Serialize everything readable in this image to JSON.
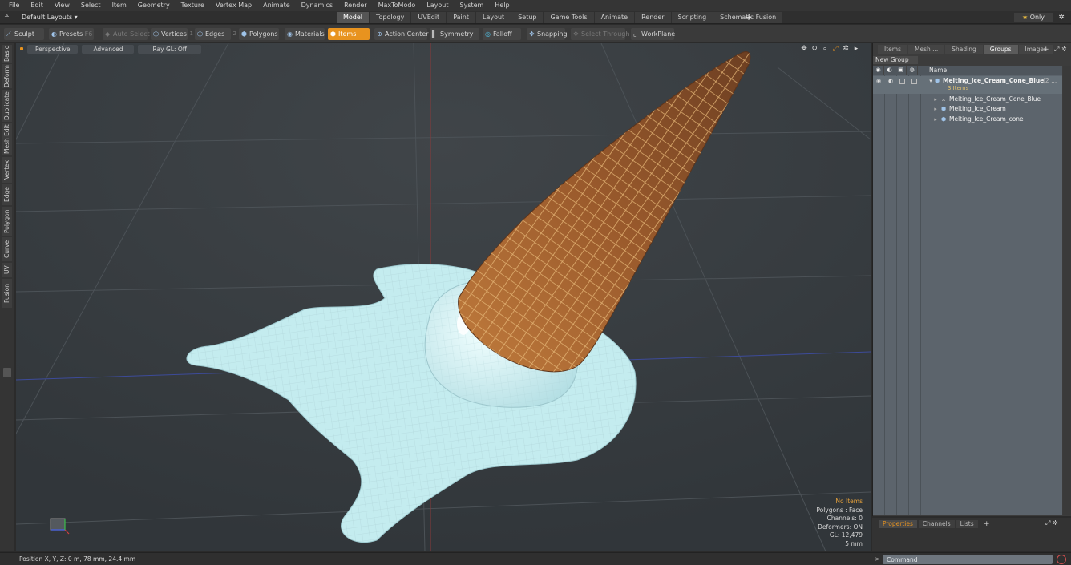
{
  "menubar": [
    "File",
    "Edit",
    "View",
    "Select",
    "Item",
    "Geometry",
    "Texture",
    "Vertex Map",
    "Animate",
    "Dynamics",
    "Render",
    "MaxToModo",
    "Layout",
    "System",
    "Help"
  ],
  "layout": {
    "selected": "Default Layouts ▾",
    "tabs": [
      "Model",
      "Topology",
      "UVEdit",
      "Paint",
      "Layout",
      "Setup",
      "Game Tools",
      "Animate",
      "Render",
      "Scripting",
      "Schematic Fusion"
    ],
    "active_tab": "Model",
    "add": "+",
    "only_star": "★",
    "only_label": "Only"
  },
  "toolbar": {
    "sculpt": "Sculpt",
    "presets": "Presets",
    "presets_key": "F6",
    "auto_select": "Auto Select",
    "vertices": "Vertices",
    "vertices_key": "1",
    "edges": "Edges",
    "edges_key": "2",
    "polygons": "Polygons",
    "materials": "Materials",
    "items": "Items",
    "action_center": "Action Center",
    "symmetry": "Symmetry",
    "falloff": "Falloff",
    "snapping": "Snapping",
    "select_through": "Select Through",
    "workplane": "WorkPlane"
  },
  "side_tabs": [
    "Basic",
    "Deform",
    "Duplicate",
    "Mesh Edit",
    "Vertex",
    "Edge",
    "Polygon",
    "Curve",
    "UV",
    "Fusion"
  ],
  "viewport": {
    "view": "Perspective",
    "mode": "Advanced",
    "raygl": "Ray GL: Off",
    "stats": {
      "items": "No Items",
      "polygons": "Polygons : Face",
      "channels": "Channels: 0",
      "deformers": "Deformers: ON",
      "gl": "GL: 12,479",
      "unit": "5 mm"
    }
  },
  "right_panel": {
    "tabs": [
      "Items",
      "Mesh ...",
      "Shading",
      "Groups",
      "Images"
    ],
    "active_tab": "Groups",
    "new_group": "New Group",
    "col_name": "Name",
    "group_name": "Melting_Ice_Cream_Cone_Blue",
    "group_suffix": "(2 ...",
    "group_count": "3 Items",
    "children": [
      "Melting_Ice_Cream_Cone_Blue",
      "Melting_Ice_Cream",
      "Melting_Ice_Cream_cone"
    ]
  },
  "properties": {
    "tabs": [
      "Properties",
      "Channels",
      "Lists"
    ],
    "active_tab": "Properties"
  },
  "statusbar": {
    "position": "Position X, Y, Z:  0 m, 78 mm, 24.4 mm",
    "command_placeholder": "Command"
  },
  "colors": {
    "accent": "#e8931f",
    "viewport_bg": "#3a3f44",
    "ice_cream": "#c8eef0",
    "cone": "#b0703a"
  }
}
